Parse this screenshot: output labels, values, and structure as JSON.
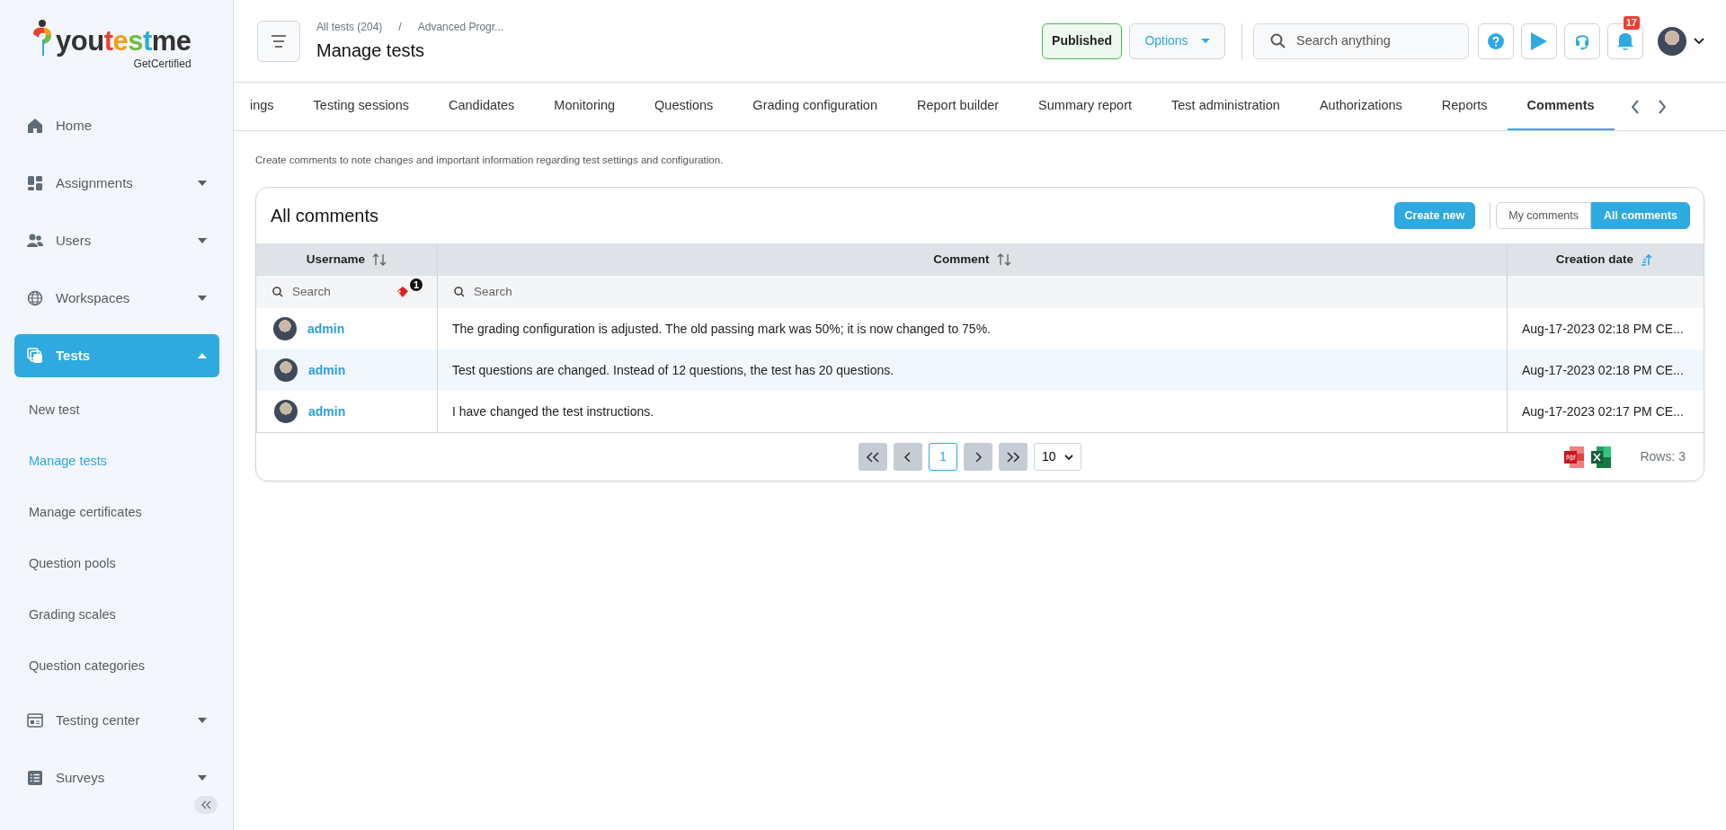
{
  "logo": {
    "text": "youtestme",
    "tagline": "GetCertified"
  },
  "sidebar": {
    "items": [
      {
        "label": "Home",
        "kind": "link",
        "selected": false
      },
      {
        "label": "Assignments",
        "kind": "group",
        "selected": false,
        "expanded": false
      },
      {
        "label": "Users",
        "kind": "group",
        "selected": false,
        "expanded": false
      },
      {
        "label": "Workspaces",
        "kind": "group",
        "selected": false,
        "expanded": false
      },
      {
        "label": "Tests",
        "kind": "group",
        "selected": true,
        "expanded": true,
        "children": [
          {
            "label": "New test",
            "selected": false
          },
          {
            "label": "Manage tests",
            "selected": true
          },
          {
            "label": "Manage certificates",
            "selected": false
          },
          {
            "label": "Question pools",
            "selected": false
          },
          {
            "label": "Grading scales",
            "selected": false
          },
          {
            "label": "Question categories",
            "selected": false
          }
        ]
      },
      {
        "label": "Testing center",
        "kind": "group",
        "selected": false,
        "expanded": false
      },
      {
        "label": "Surveys",
        "kind": "group",
        "selected": false,
        "expanded": false
      }
    ]
  },
  "header": {
    "breadcrumb": [
      "All tests (204)",
      "/",
      "Advanced Progr..."
    ],
    "title": "Manage tests",
    "status": "Published",
    "options": "Options",
    "search": {
      "placeholder": "Search anything"
    },
    "notifications": "17"
  },
  "tabs": [
    {
      "label": "ings",
      "selected": false
    },
    {
      "label": "Testing sessions",
      "selected": false
    },
    {
      "label": "Candidates",
      "selected": false
    },
    {
      "label": "Monitoring",
      "selected": false
    },
    {
      "label": "Questions",
      "selected": false
    },
    {
      "label": "Grading configuration",
      "selected": false
    },
    {
      "label": "Report builder",
      "selected": false
    },
    {
      "label": "Summary report",
      "selected": false
    },
    {
      "label": "Test administration",
      "selected": false
    },
    {
      "label": "Authorizations",
      "selected": false
    },
    {
      "label": "Reports",
      "selected": false
    },
    {
      "label": "Comments",
      "selected": true
    }
  ],
  "description": "Create comments to note changes and important information regarding test settings and configuration.",
  "panel": {
    "title": "All comments",
    "create": "Create new",
    "filters": [
      {
        "label": "My comments",
        "selected": false
      },
      {
        "label": "All comments",
        "selected": true
      }
    ]
  },
  "table": {
    "columns": [
      {
        "label": "Username",
        "sorted": false,
        "filter": {
          "placeholder": "Search",
          "badge": "1"
        }
      },
      {
        "label": "Comment",
        "sorted": false,
        "filter": {
          "placeholder": "Search"
        }
      },
      {
        "label": "Creation date",
        "sorted": true
      }
    ],
    "rows": [
      {
        "username": "admin",
        "comment": "The grading configuration is adjusted. The old passing mark was 50%; it is now changed to 75%.",
        "date": "Aug-17-2023 02:18 PM CE..."
      },
      {
        "username": "admin",
        "comment": "Test questions are changed. Instead of 12 questions, the test has 20 questions.",
        "date": "Aug-17-2023 02:18 PM CE..."
      },
      {
        "username": "admin",
        "comment": "I have changed the test instructions.",
        "date": "Aug-17-2023 02:17 PM CE..."
      }
    ]
  },
  "pagination": {
    "pages": [
      {
        "label": "1",
        "selected": true
      }
    ],
    "page_size": "10",
    "rows": "Rows: 3"
  }
}
